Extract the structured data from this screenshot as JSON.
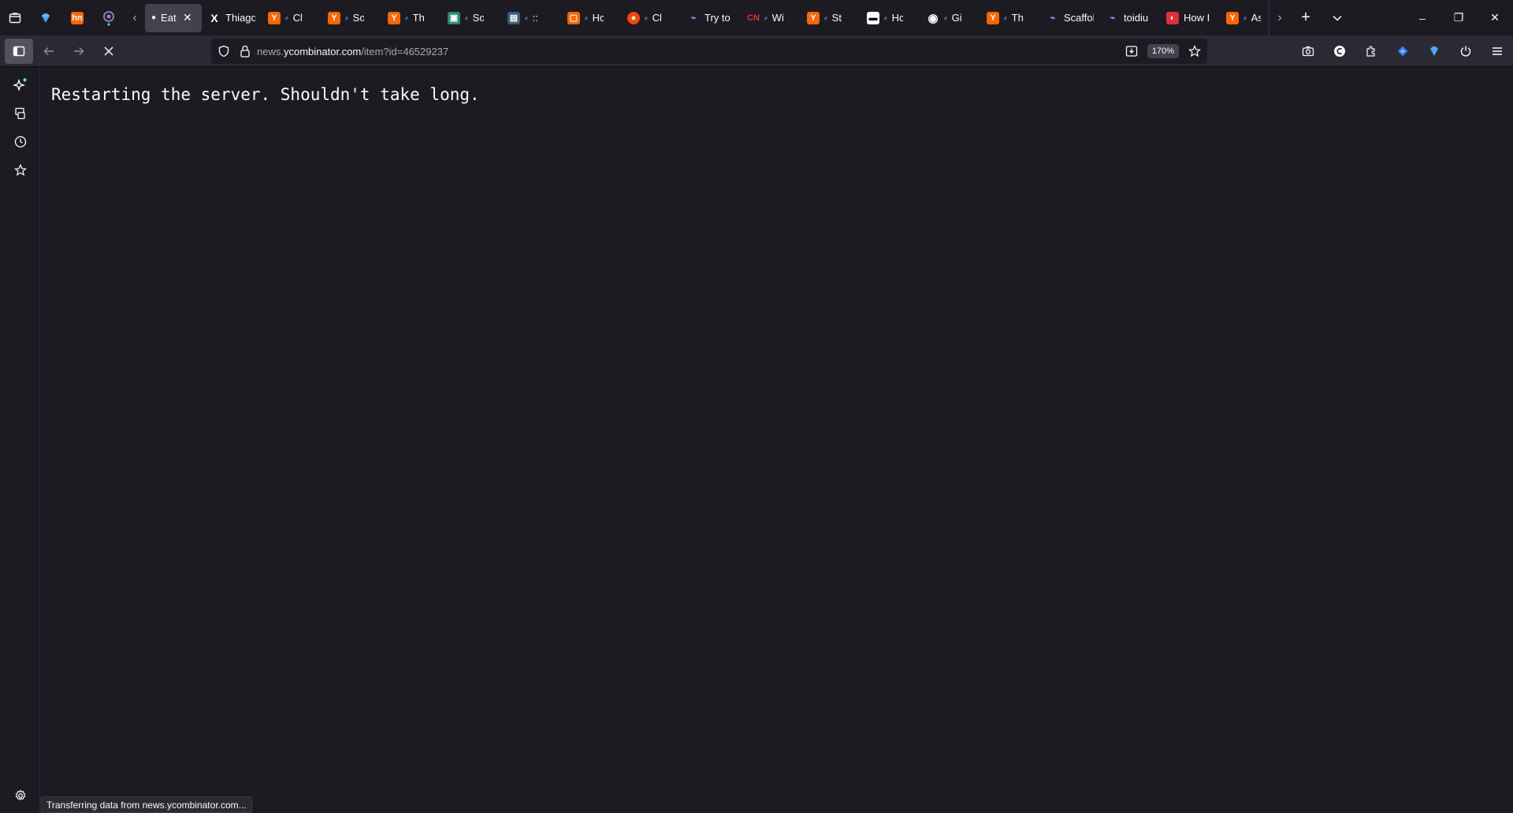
{
  "tabs": {
    "pinned": [
      {
        "label": "",
        "icon": "gem-icon",
        "color": "#4aa3ff"
      },
      {
        "label": "hn",
        "icon": "hn-icon",
        "color": "#ff6600"
      },
      {
        "label": "",
        "icon": "chatbot-icon",
        "color": "#7d7d8a"
      }
    ],
    "active": {
      "label": "Eat",
      "icon": "dot-icon"
    },
    "items": [
      {
        "label": "Thiago",
        "fav": "X",
        "fav_color": "#000000"
      },
      {
        "label": "Cl",
        "fav": "Y",
        "fav_color": "#ff6600"
      },
      {
        "label": "So",
        "fav": "Y",
        "fav_color": "#ff6600"
      },
      {
        "label": "Th",
        "fav": "Y",
        "fav_color": "#ff6600"
      },
      {
        "label": "So",
        "fav": "▣",
        "fav_color": "#2e8b6b"
      },
      {
        "label": "::",
        "fav": "▤",
        "fav_color": "#3b5b7b"
      },
      {
        "label": "Hc",
        "fav": "▢",
        "fav_color": "#ff6600"
      },
      {
        "label": "Cl",
        "fav": "●",
        "fav_color": "#ff4500"
      },
      {
        "label": "Try to",
        "fav": "⌁",
        "fav_color": "#2b2a33"
      },
      {
        "label": "Wi",
        "fav": "CN",
        "fav_color": "#1c1b22"
      },
      {
        "label": "St",
        "fav": "Y",
        "fav_color": "#ff6600"
      },
      {
        "label": "Hc",
        "fav": "▬",
        "fav_color": "#ffffff"
      },
      {
        "label": "Gi",
        "fav": "◉",
        "fav_color": "#1c1b22"
      },
      {
        "label": "Th",
        "fav": "Y",
        "fav_color": "#ff6600"
      },
      {
        "label": "Scaffol",
        "fav": "⌁",
        "fav_color": "#2b2a33"
      },
      {
        "label": "toidiu",
        "fav": "⌁",
        "fav_color": "#2b2a33"
      },
      {
        "label": "How I",
        "fav": "◐",
        "fav_color": "#e0303a"
      },
      {
        "label": "As",
        "fav": "Y",
        "fav_color": "#ff6600"
      }
    ]
  },
  "window_controls": {
    "minimize": "–",
    "restore": "❐",
    "close": "✕"
  },
  "navbar": {
    "url_host_prefix": "news.",
    "url_host": "ycombinator.com",
    "url_path": "/item?id=46529237",
    "zoom": "170%"
  },
  "content": {
    "message": "Restarting the server. Shouldn't take long."
  },
  "status_bar": {
    "text": "Transferring data from news.ycombinator.com..."
  }
}
